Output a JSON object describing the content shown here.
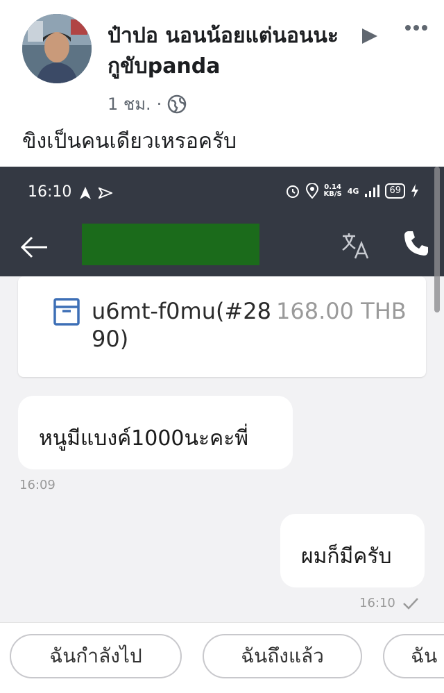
{
  "post": {
    "title_line1": "ป๋าปอ นอนน้อยแต่นอนนะ",
    "title_line2": "กูขับpanda",
    "time": "1 ชม.",
    "separator": "·",
    "text": "ขิงเป็นคนเดียวเหรอครับ"
  },
  "screenshot": {
    "status": {
      "time": "16:10",
      "net_speed_value": "0.14",
      "net_speed_unit": "KB/S",
      "network": "4G",
      "battery": "69"
    },
    "order": {
      "id": "u6mt-f0mu(#2890)",
      "amount": "168.00 THB"
    },
    "messages": [
      {
        "direction": "incoming",
        "text": "หนูมีแบงค์1000นะคะพี่",
        "time": "16:09"
      },
      {
        "direction": "outgoing",
        "text": "ผมก็มีครับ",
        "time": "16:10"
      }
    ],
    "quick_replies": [
      "ฉันกำลังไป",
      "ฉันถึงแล้ว",
      "ฉัน"
    ]
  },
  "colors": {
    "status_bar": "#343943",
    "redaction": "#1b6b1b",
    "chat_bg": "#f2f2f4"
  },
  "icons": [
    "play-icon",
    "more-icon",
    "globe-icon",
    "navigation-icon",
    "send-icon",
    "alarm-icon",
    "location-icon",
    "signal-icon",
    "battery-icon",
    "back-icon",
    "translate-icon",
    "phone-icon",
    "box-icon",
    "check-icon"
  ]
}
